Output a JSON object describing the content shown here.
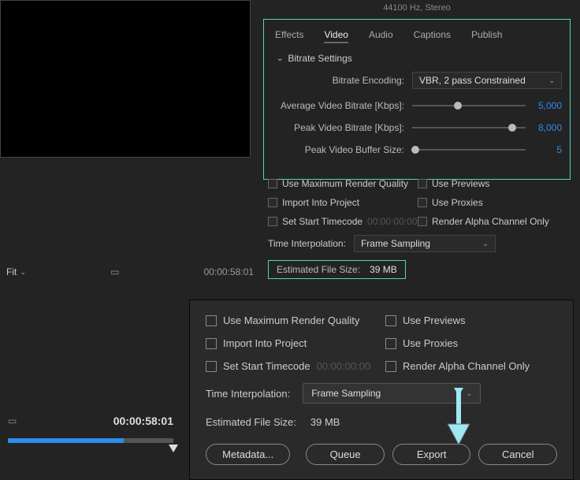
{
  "audioInfo": "44100 Hz, Stereo",
  "tabs": {
    "effects": "Effects",
    "video": "Video",
    "audio": "Audio",
    "captions": "Captions",
    "publish": "Publish"
  },
  "section": "Bitrate Settings",
  "encodingLabel": "Bitrate Encoding:",
  "encodingValue": "VBR, 2 pass Constrained",
  "avgLabel": "Average Video Bitrate [Kbps]:",
  "avgValue": "5,000",
  "peakLabel": "Peak Video Bitrate [Kbps]:",
  "peakValue": "8,000",
  "bufLabel": "Peak Video Buffer Size:",
  "bufValue": "5",
  "opts": {
    "maxRender": "Use Maximum Render Quality",
    "previews": "Use Previews",
    "import": "Import Into Project",
    "proxies": "Use Proxies",
    "startTC": "Set Start Timecode",
    "tcVal": "00:00:00:00",
    "alpha": "Render Alpha Channel Only"
  },
  "tiLabel": "Time Interpolation:",
  "tiValue": "Frame Sampling",
  "estLabel": "Estimated File Size:",
  "estValue": "39 MB",
  "fit": "Fit",
  "tcA": "00:00:58:01",
  "tcB": "00:00:58:01",
  "buttons": {
    "metadata": "Metadata...",
    "queue": "Queue",
    "export": "Export",
    "cancel": "Cancel"
  }
}
